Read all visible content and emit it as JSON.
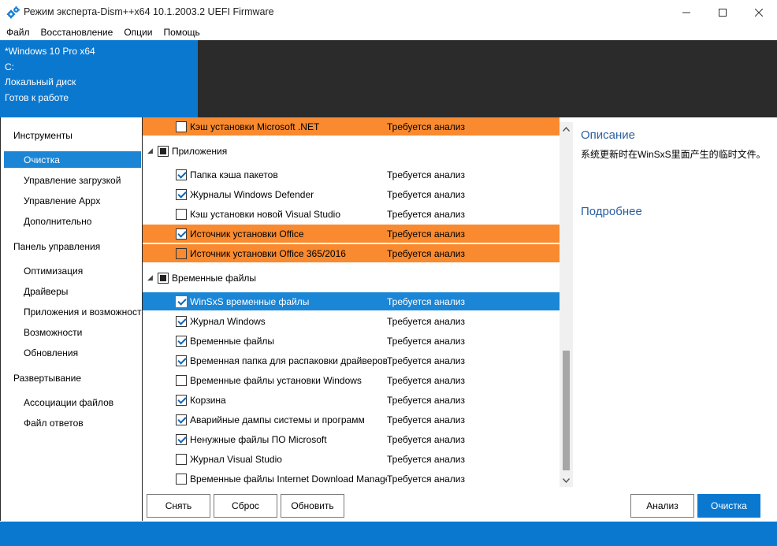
{
  "window": {
    "title": "Режим эксперта-Dism++x64 10.1.2003.2 UEFI Firmware",
    "minimize_glyph": "—",
    "maximize_glyph": "☐",
    "close_glyph": "✕"
  },
  "menu": [
    "Файл",
    "Восстановление",
    "Опции",
    "Помощь"
  ],
  "header": {
    "os": "*Windows 10 Pro x64",
    "drive": "C:",
    "disk": "Локальный диск",
    "state": "Готов к работе"
  },
  "nav": {
    "tools": "Инструменты",
    "cleanup": "Очистка",
    "boot": "Управление загрузкой",
    "appx": "Управление Appx",
    "extra": "Дополнительно",
    "control_panel": "Панель управления",
    "optimize": "Оптимизация",
    "drivers": "Драйверы",
    "apps": "Приложения и возможности",
    "features": "Возможности",
    "updates": "Обновления",
    "deploy": "Развертывание",
    "assoc": "Ассоциации файлов",
    "answer": "Файл ответов"
  },
  "list": {
    "row0": {
      "name": "Кэш установки Microsoft .NET",
      "status": "Требуется анализ"
    },
    "group_apps": "Приложения",
    "row1": {
      "name": "Папка кэша пакетов",
      "status": "Требуется анализ"
    },
    "row2": {
      "name": "Журналы Windows Defender",
      "status": "Требуется анализ"
    },
    "row3": {
      "name": "Кэш установки новой Visual Studio",
      "status": "Требуется анализ"
    },
    "row4": {
      "name": "Источник установки Office",
      "status": "Требуется анализ"
    },
    "row5": {
      "name": "Источник установки Office 365/2016",
      "status": "Требуется анализ"
    },
    "group_temp": "Временные файлы",
    "row6": {
      "name": "WinSxS временные файлы",
      "status": "Требуется анализ"
    },
    "row7": {
      "name": "Журнал Windows",
      "status": "Требуется анализ"
    },
    "row8": {
      "name": "Временные файлы",
      "status": "Требуется анализ"
    },
    "row9": {
      "name": "Временная папка для распаковки драйверов",
      "status": "Требуется анализ"
    },
    "row10": {
      "name": "Временные файлы установки Windows",
      "status": "Требуется анализ"
    },
    "row11": {
      "name": "Корзина",
      "status": "Требуется анализ"
    },
    "row12": {
      "name": "Аварийные дампы системы и программ",
      "status": "Требуется анализ"
    },
    "row13": {
      "name": "Ненужные файлы ПО Microsoft",
      "status": "Требуется анализ"
    },
    "row14": {
      "name": "Журнал Visual Studio",
      "status": "Требуется анализ"
    },
    "row15": {
      "name": "Временные файлы Internet Download Manager",
      "status": "Требуется анализ"
    },
    "checked": [
      false,
      true,
      true,
      false,
      true,
      false,
      true,
      true,
      true,
      true,
      false,
      true,
      true,
      true,
      false,
      false
    ]
  },
  "details": {
    "description_title": "Описание",
    "description_text": "系统更新时在WinSxS里面产生的临时文件。",
    "more_title": "Подробнее"
  },
  "buttons": {
    "uncheck": "Снять",
    "reset": "Сброс",
    "refresh": "Обновить",
    "analyze": "Анализ",
    "clean": "Очистка"
  },
  "colors": {
    "accent": "#0b78d0",
    "highlight_orange": "#f98a2f",
    "selection_blue": "#1b85d6",
    "header_dark": "#2b2b2b"
  },
  "icons": [
    "gears-icon",
    "minimize-icon",
    "maximize-icon",
    "close-icon",
    "chevron-up-icon",
    "chevron-down-icon",
    "collapse-arrow-icon",
    "checkmark-icon"
  ]
}
